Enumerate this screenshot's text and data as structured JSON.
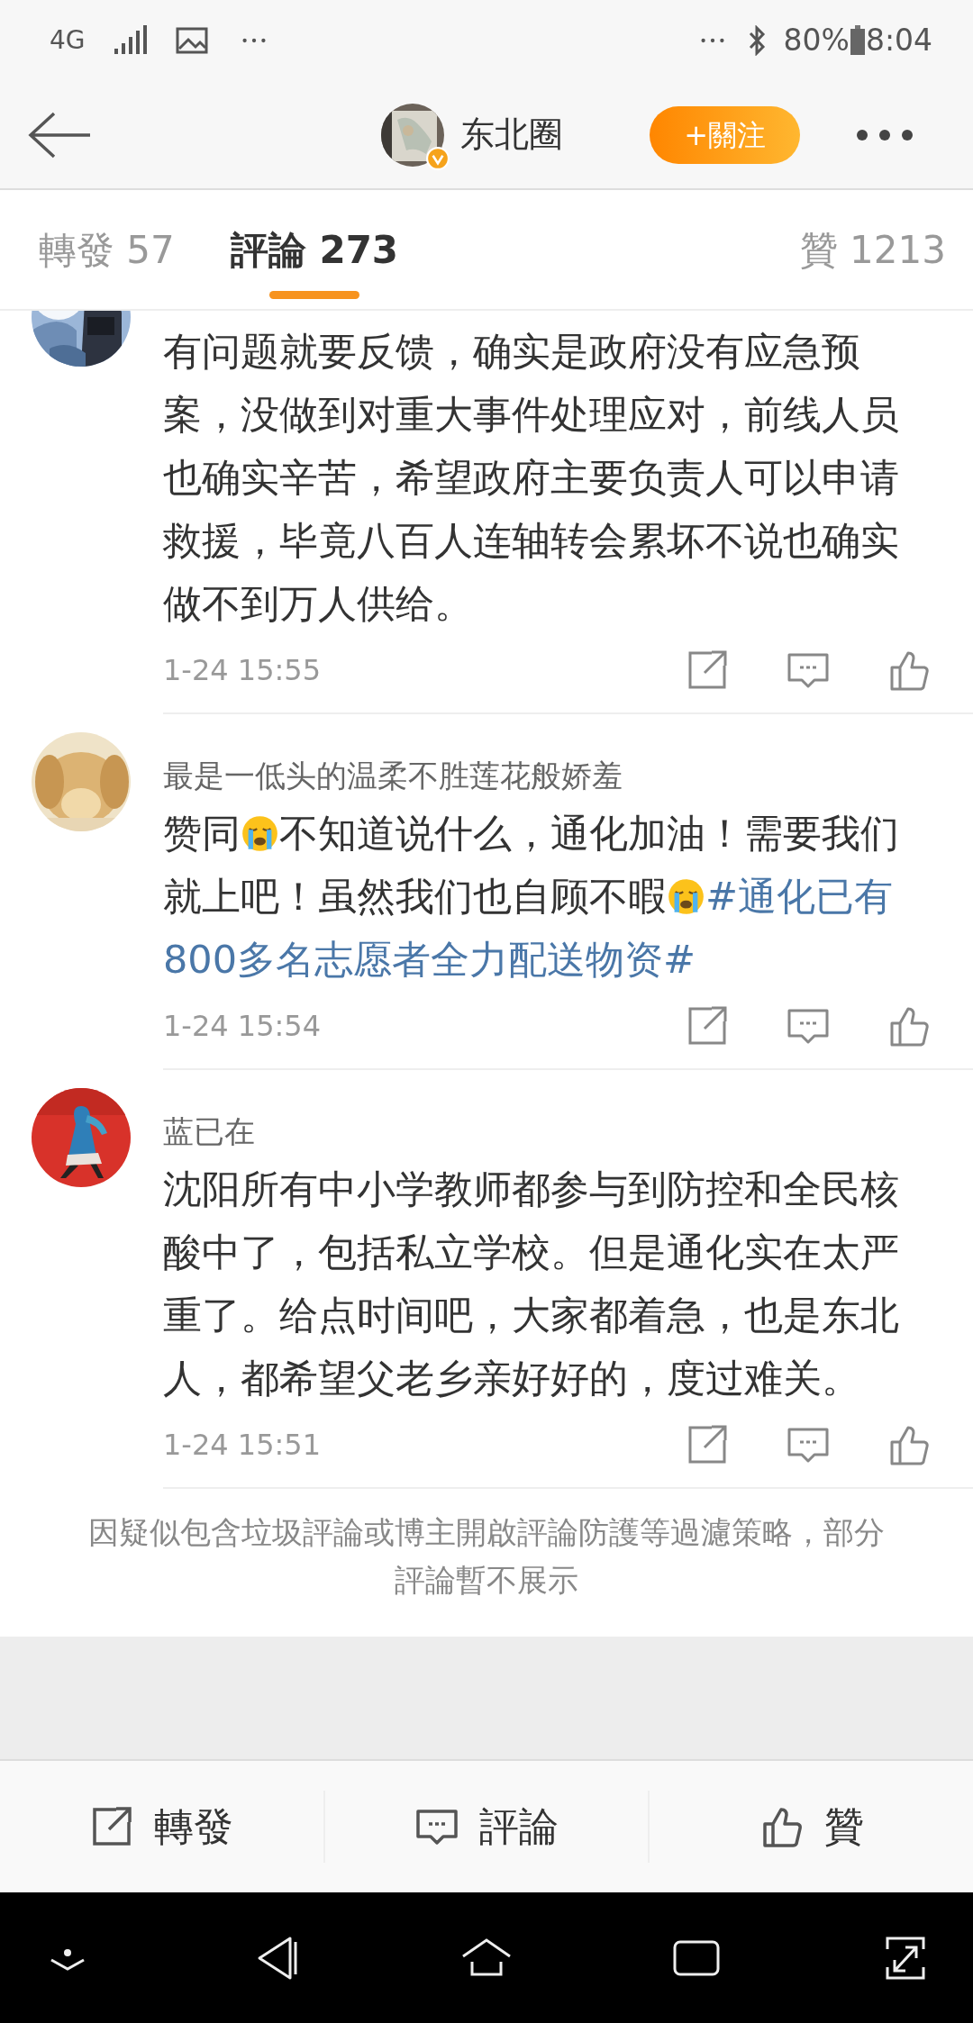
{
  "status_bar": {
    "network": "4G",
    "battery": "80%",
    "time": "8:04"
  },
  "header": {
    "account_name": "东北圈",
    "follow_button": "+關注"
  },
  "tabs": [
    {
      "label": "轉發 57",
      "selected": false
    },
    {
      "label": "評論 273",
      "selected": true
    },
    {
      "label": "贊 1213",
      "selected": false
    }
  ],
  "comments": [
    {
      "segments": [
        {
          "kind": "text",
          "text": "有问题就要反馈，确实是政府没有应急预案，没做到对重大事件处理应对，前线人员也确实辛苦，希望政府主要负责人可以申请救援，毕竟八百人连轴转会累坏不说也确实做不到万人供给。"
        }
      ],
      "time": "1-24 15:55"
    },
    {
      "user": "最是一低头的温柔不胜莲花般娇羞",
      "segments": [
        {
          "kind": "text",
          "text": "赞同"
        },
        {
          "kind": "emoji"
        },
        {
          "kind": "text",
          "text": "不知道说什么，通化加油！需要我们就上吧！虽然我们也自顾不暇"
        },
        {
          "kind": "emoji"
        },
        {
          "kind": "hashtag",
          "text": "#通化已有800多名志愿者全力配送物资#"
        }
      ],
      "time": "1-24 15:54"
    },
    {
      "user": "蓝已在",
      "segments": [
        {
          "kind": "text",
          "text": "沈阳所有中小学教师都参与到防控和全民核酸中了，包括私立学校。但是通化实在太严重了。给点时间吧，大家都着急，也是东北人，都希望父老乡亲好好的，度过难关。"
        }
      ],
      "time": "1-24 15:51"
    }
  ],
  "notice": "因疑似包含垃圾評論或博主開啟評論防護等過濾策略，部分評論暫不展示",
  "action_bar": [
    "轉發",
    "評論",
    "贊"
  ]
}
